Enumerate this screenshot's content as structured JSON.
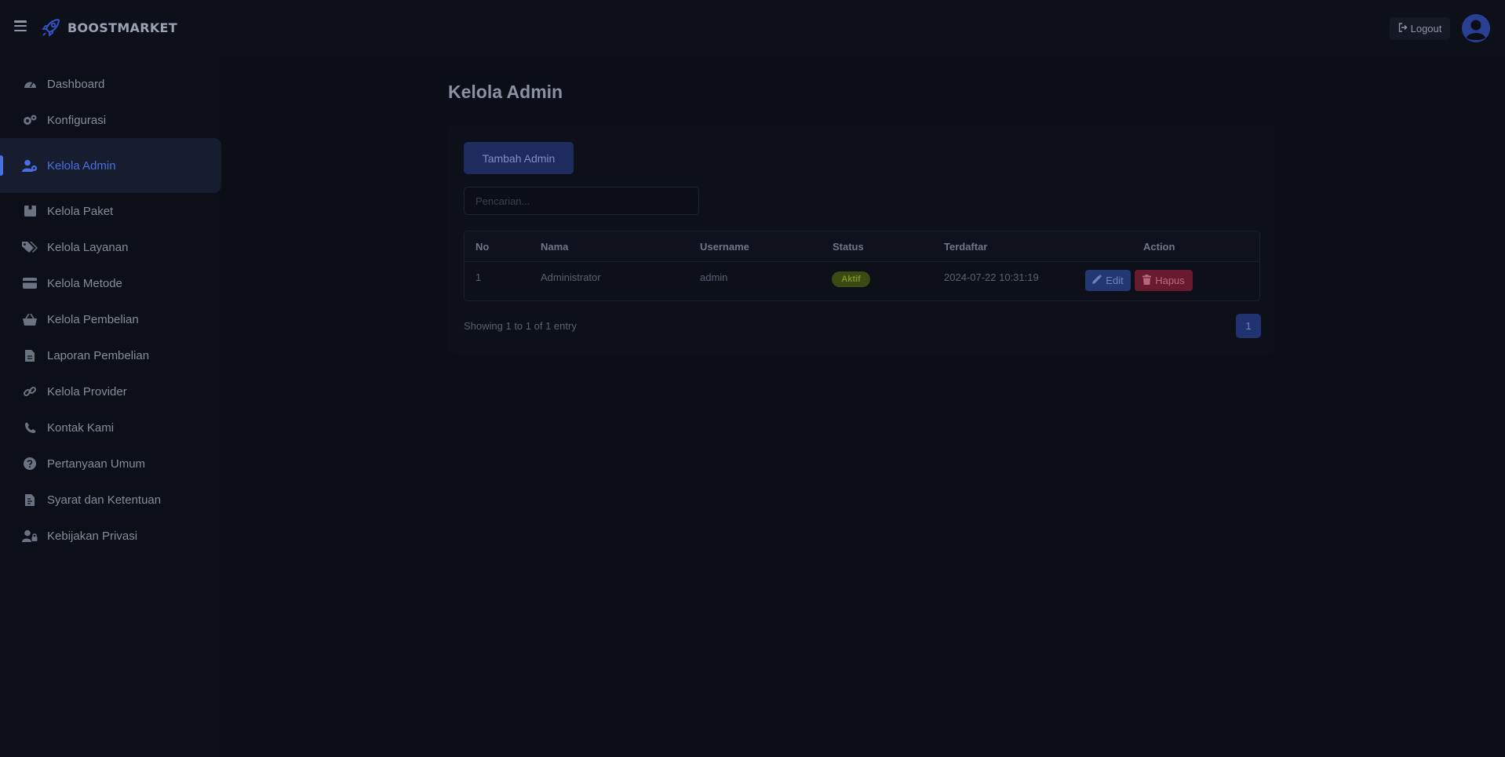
{
  "brand": {
    "name": "BOOSTMARKET"
  },
  "header": {
    "logout_label": "Logout"
  },
  "sidebar": {
    "items": [
      {
        "label": "Dashboard",
        "icon": "gauge-icon"
      },
      {
        "label": "Konfigurasi",
        "icon": "gears-icon"
      },
      {
        "label": "Kelola Admin",
        "icon": "user-gear-icon",
        "active": true
      },
      {
        "label": "Kelola Paket",
        "icon": "box-icon"
      },
      {
        "label": "Kelola Layanan",
        "icon": "tags-icon"
      },
      {
        "label": "Kelola Metode",
        "icon": "credit-card-icon"
      },
      {
        "label": "Kelola Pembelian",
        "icon": "basket-icon"
      },
      {
        "label": "Laporan Pembelian",
        "icon": "file-icon"
      },
      {
        "label": "Kelola Provider",
        "icon": "link-icon"
      },
      {
        "label": "Kontak Kami",
        "icon": "phone-icon"
      },
      {
        "label": "Pertanyaan Umum",
        "icon": "question-circle-icon"
      },
      {
        "label": "Syarat dan Ketentuan",
        "icon": "file-contract-icon"
      },
      {
        "label": "Kebijakan Privasi",
        "icon": "user-lock-icon"
      }
    ]
  },
  "main": {
    "title": "Kelola Admin",
    "add_button_label": "Tambah Admin",
    "search_placeholder": "Pencarian...",
    "table": {
      "columns": [
        "No",
        "Nama",
        "Username",
        "Status",
        "Terdaftar",
        "Action"
      ],
      "rows": [
        {
          "no": "1",
          "nama": "Administrator",
          "username": "admin",
          "status": "Aktif",
          "terdaftar": "2024-07-22 10:31:19",
          "edit_label": "Edit",
          "delete_label": "Hapus"
        }
      ]
    },
    "showing_text": "Showing 1 to 1 of 1 entry",
    "pagination": {
      "current_page": "1"
    }
  },
  "colors": {
    "accent": "#4a6fe0",
    "primary_button": "#1e2b5e",
    "success_badge": "#3b4a12",
    "danger_button": "#6a1a2e",
    "background": "#0b0e17"
  }
}
